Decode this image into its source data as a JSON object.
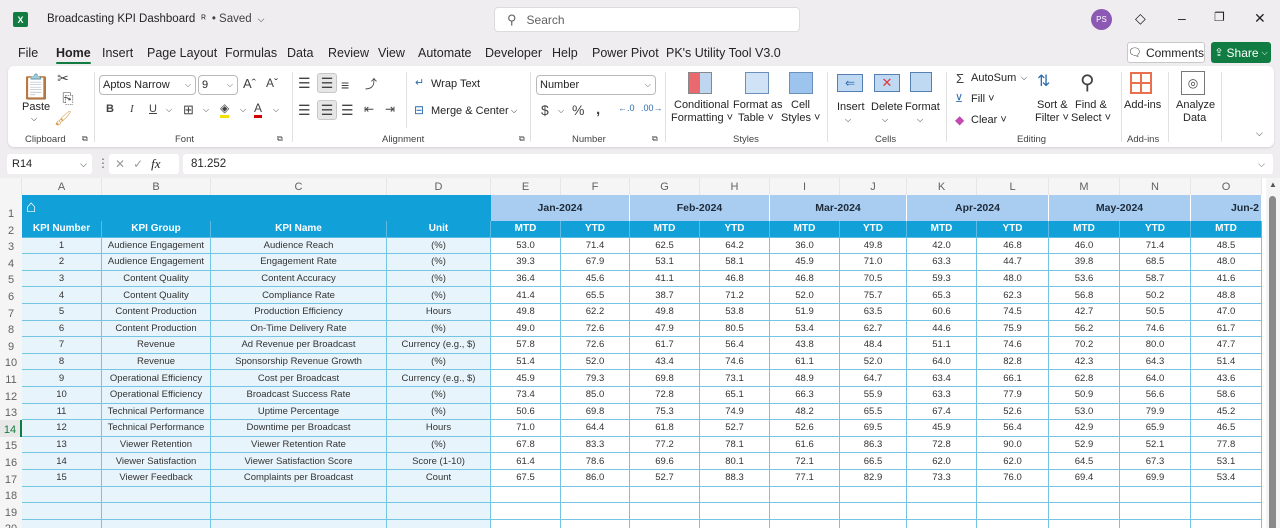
{
  "app": {
    "logo": "X",
    "title": "Broadcasting KPI Dashboard",
    "status": "• Saved",
    "search_placeholder": "Search",
    "user_initials": "PS"
  },
  "menu": [
    "File",
    "Home",
    "Insert",
    "Page Layout",
    "Formulas",
    "Data",
    "Review",
    "View",
    "Automate",
    "Developer",
    "Help",
    "Power Pivot",
    "PK's Utility Tool V3.0"
  ],
  "menu_active": "Home",
  "header_buttons": {
    "comments": "Comments",
    "share": "Share"
  },
  "ribbon": {
    "clipboard": {
      "paste": "Paste",
      "label": "Clipboard"
    },
    "font": {
      "name": "Aptos Narrow",
      "size": "9",
      "label": "Font"
    },
    "alignment": {
      "wrap": "Wrap Text",
      "merge": "Merge & Center",
      "label": "Alignment"
    },
    "number": {
      "format": "Number",
      "label": "Number"
    },
    "styles": {
      "conditional_1": "Conditional",
      "conditional_2": "Formatting ˅",
      "table_1": "Format as",
      "table_2": "Table ˅",
      "cell_1": "Cell",
      "cell_2": "Styles ˅",
      "label": "Styles"
    },
    "cells": {
      "insert": "Insert",
      "delete": "Delete",
      "format": "Format",
      "label": "Cells"
    },
    "editing": {
      "autosum": "AutoSum",
      "fill": "Fill ˅",
      "clear": "Clear ˅",
      "sort_1": "Sort &",
      "sort_2": "Filter ˅",
      "find_1": "Find &",
      "find_2": "Select ˅",
      "label": "Editing"
    },
    "addins": {
      "addins": "Add-ins",
      "label": "Add-ins"
    },
    "analyze": {
      "line1": "Analyze",
      "line2": "Data"
    }
  },
  "formula_bar": {
    "cell_ref": "R14",
    "value": "81.252"
  },
  "columns": [
    "A",
    "B",
    "C",
    "D",
    "E",
    "F",
    "G",
    "H",
    "I",
    "J",
    "K",
    "L",
    "M",
    "N",
    "O"
  ],
  "rows_visible": [
    "1",
    "2",
    "3",
    "4",
    "5",
    "6",
    "7",
    "8",
    "9",
    "10",
    "11",
    "12",
    "13",
    "14",
    "15",
    "16",
    "17",
    "18",
    "19",
    "20"
  ],
  "selected_row": "14",
  "table": {
    "headers": [
      "KPI Number",
      "KPI Group",
      "KPI Name",
      "Unit"
    ],
    "months": [
      "Jan-2024",
      "Feb-2024",
      "Mar-2024",
      "Apr-2024",
      "May-2024",
      "Jun-2"
    ],
    "sub_headers": [
      "MTD",
      "YTD"
    ],
    "rows": [
      {
        "num": "1",
        "group": "Audience Engagement",
        "name": "Audience Reach",
        "unit": "(%)",
        "values": [
          "53.0",
          "71.4",
          "62.5",
          "64.2",
          "36.0",
          "49.8",
          "42.0",
          "46.8",
          "46.0",
          "71.4",
          "48.5"
        ]
      },
      {
        "num": "2",
        "group": "Audience Engagement",
        "name": "Engagement Rate",
        "unit": "(%)",
        "values": [
          "39.3",
          "67.9",
          "53.1",
          "58.1",
          "45.9",
          "71.0",
          "63.3",
          "44.7",
          "39.8",
          "68.5",
          "48.0"
        ]
      },
      {
        "num": "3",
        "group": "Content Quality",
        "name": "Content Accuracy",
        "unit": "(%)",
        "values": [
          "36.4",
          "45.6",
          "41.1",
          "46.8",
          "46.8",
          "70.5",
          "59.3",
          "48.0",
          "53.6",
          "58.7",
          "41.6"
        ]
      },
      {
        "num": "4",
        "group": "Content Quality",
        "name": "Compliance Rate",
        "unit": "(%)",
        "values": [
          "41.4",
          "65.5",
          "38.7",
          "71.2",
          "52.0",
          "75.7",
          "65.3",
          "62.3",
          "56.8",
          "50.2",
          "48.8"
        ]
      },
      {
        "num": "5",
        "group": "Content Production",
        "name": "Production Efficiency",
        "unit": "Hours",
        "values": [
          "49.8",
          "62.2",
          "49.8",
          "53.8",
          "51.9",
          "63.5",
          "60.6",
          "74.5",
          "42.7",
          "50.5",
          "47.0"
        ]
      },
      {
        "num": "6",
        "group": "Content Production",
        "name": "On-Time Delivery Rate",
        "unit": "(%)",
        "values": [
          "49.0",
          "72.6",
          "47.9",
          "80.5",
          "53.4",
          "62.7",
          "44.6",
          "75.9",
          "56.2",
          "74.6",
          "61.7"
        ]
      },
      {
        "num": "7",
        "group": "Revenue",
        "name": "Ad Revenue per Broadcast",
        "unit": "Currency (e.g., $)",
        "values": [
          "57.8",
          "72.6",
          "61.7",
          "56.4",
          "43.8",
          "48.4",
          "51.1",
          "74.6",
          "70.2",
          "80.0",
          "47.7"
        ]
      },
      {
        "num": "8",
        "group": "Revenue",
        "name": "Sponsorship Revenue Growth",
        "unit": "(%)",
        "values": [
          "51.4",
          "52.0",
          "43.4",
          "74.6",
          "61.1",
          "52.0",
          "64.0",
          "82.8",
          "42.3",
          "64.3",
          "51.4"
        ]
      },
      {
        "num": "9",
        "group": "Operational Efficiency",
        "name": "Cost per Broadcast",
        "unit": "Currency (e.g., $)",
        "values": [
          "45.9",
          "79.3",
          "69.8",
          "73.1",
          "48.9",
          "64.7",
          "63.4",
          "66.1",
          "62.8",
          "64.0",
          "43.6"
        ]
      },
      {
        "num": "10",
        "group": "Operational Efficiency",
        "name": "Broadcast Success Rate",
        "unit": "(%)",
        "values": [
          "73.4",
          "85.0",
          "72.8",
          "65.1",
          "66.3",
          "55.9",
          "63.3",
          "77.9",
          "50.9",
          "56.6",
          "58.6"
        ]
      },
      {
        "num": "11",
        "group": "Technical Performance",
        "name": "Uptime Percentage",
        "unit": "(%)",
        "values": [
          "50.6",
          "69.8",
          "75.3",
          "74.9",
          "48.2",
          "65.5",
          "67.4",
          "52.6",
          "53.0",
          "79.9",
          "45.2"
        ]
      },
      {
        "num": "12",
        "group": "Technical Performance",
        "name": "Downtime per Broadcast",
        "unit": "Hours",
        "values": [
          "71.0",
          "64.4",
          "61.8",
          "52.7",
          "52.6",
          "69.5",
          "45.9",
          "56.4",
          "42.9",
          "65.9",
          "46.5"
        ]
      },
      {
        "num": "13",
        "group": "Viewer Retention",
        "name": "Viewer Retention Rate",
        "unit": "(%)",
        "values": [
          "67.8",
          "83.3",
          "77.2",
          "78.1",
          "61.6",
          "86.3",
          "72.8",
          "90.0",
          "52.9",
          "52.1",
          "77.8"
        ]
      },
      {
        "num": "14",
        "group": "Viewer Satisfaction",
        "name": "Viewer Satisfaction Score",
        "unit": "Score (1-10)",
        "values": [
          "61.4",
          "78.6",
          "69.6",
          "80.1",
          "72.1",
          "66.5",
          "62.0",
          "62.0",
          "64.5",
          "67.3",
          "53.1"
        ]
      },
      {
        "num": "15",
        "group": "Viewer Feedback",
        "name": "Complaints per Broadcast",
        "unit": "Count",
        "values": [
          "67.5",
          "86.0",
          "52.7",
          "88.3",
          "77.1",
          "82.9",
          "73.3",
          "76.0",
          "69.4",
          "69.9",
          "53.4"
        ]
      }
    ]
  },
  "colors": {
    "header_blue": "#11a0d8",
    "month_band": "#a8cdf0",
    "excel_green": "#107c41"
  }
}
